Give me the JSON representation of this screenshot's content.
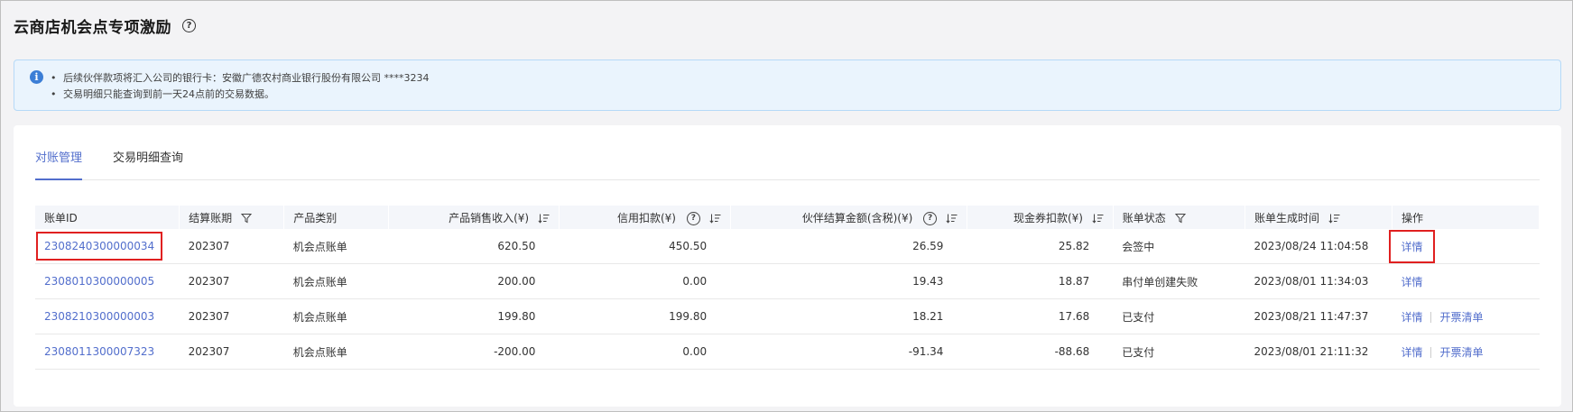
{
  "page": {
    "title": "云商店机会点专项激励"
  },
  "notice": {
    "lines": [
      "后续伙伴款项将汇入公司的银行卡：安徽广德农村商业银行股份有限公司 ****3234",
      "交易明细只能查询到前一天24点前的交易数据。"
    ]
  },
  "tabs": [
    {
      "label": "对账管理",
      "active": true
    },
    {
      "label": "交易明细查询",
      "active": false
    }
  ],
  "table": {
    "columns": [
      "账单ID",
      "结算账期",
      "产品类别",
      "产品销售收入(¥)",
      "信用扣款(¥)",
      "伙伴结算金额(含税)(¥)",
      "现金券扣款(¥)",
      "账单状态",
      "账单生成时间",
      "操作"
    ],
    "rows": [
      {
        "id": "2308240300000034",
        "period": "202307",
        "category": "机会点账单",
        "revenue": "620.50",
        "credit": "450.50",
        "settle": "26.59",
        "coupon": "25.82",
        "status": "会签中",
        "time": "2023/08/24 11:04:58",
        "actions": [
          "详情"
        ]
      },
      {
        "id": "2308010300000005",
        "period": "202307",
        "category": "机会点账单",
        "revenue": "200.00",
        "credit": "0.00",
        "settle": "19.43",
        "coupon": "18.87",
        "status": "串付单创建失败",
        "time": "2023/08/01 11:34:03",
        "actions": [
          "详情"
        ]
      },
      {
        "id": "2308210300000003",
        "period": "202307",
        "category": "机会点账单",
        "revenue": "199.80",
        "credit": "199.80",
        "settle": "18.21",
        "coupon": "17.68",
        "status": "已支付",
        "time": "2023/08/21 11:47:37",
        "actions": [
          "详情",
          "开票清单"
        ]
      },
      {
        "id": "2308011300007323",
        "period": "202307",
        "category": "机会点账单",
        "revenue": "-200.00",
        "credit": "0.00",
        "settle": "-91.34",
        "coupon": "-88.68",
        "status": "已支付",
        "time": "2023/08/01 21:11:32",
        "actions": [
          "详情",
          "开票清单"
        ]
      }
    ]
  },
  "colors": {
    "accent": "#526ecc",
    "highlight": "#e02020",
    "notice_bg": "#eaf4fd"
  }
}
